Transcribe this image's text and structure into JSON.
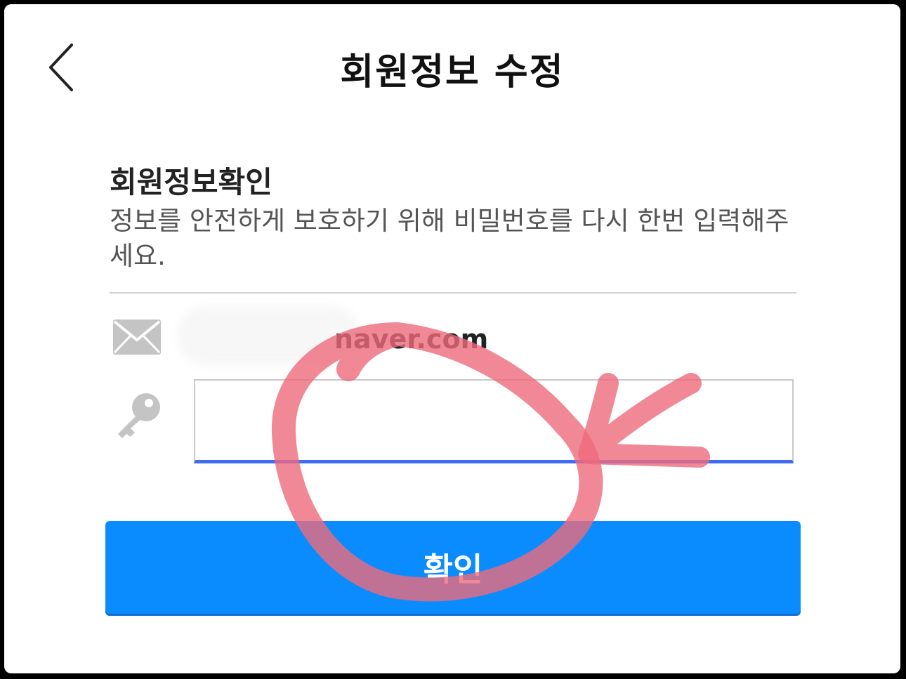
{
  "header": {
    "title": "회원정보 수정",
    "back_icon": "chevron-left-icon"
  },
  "section": {
    "title": "회원정보확인",
    "description": "정보를 안전하게 보호하기 위해 비밀번호를 다시 한번 입력해주세요."
  },
  "email": {
    "icon": "envelope-icon",
    "value_visible": "naver.com"
  },
  "password": {
    "icon": "key-icon",
    "value": "",
    "placeholder": ""
  },
  "confirm_button": {
    "label": "확인",
    "color": "#0a8cff"
  },
  "colors": {
    "input_focus_underline": "#3d6cf2",
    "annotation_marker": "#ee6a7c"
  }
}
